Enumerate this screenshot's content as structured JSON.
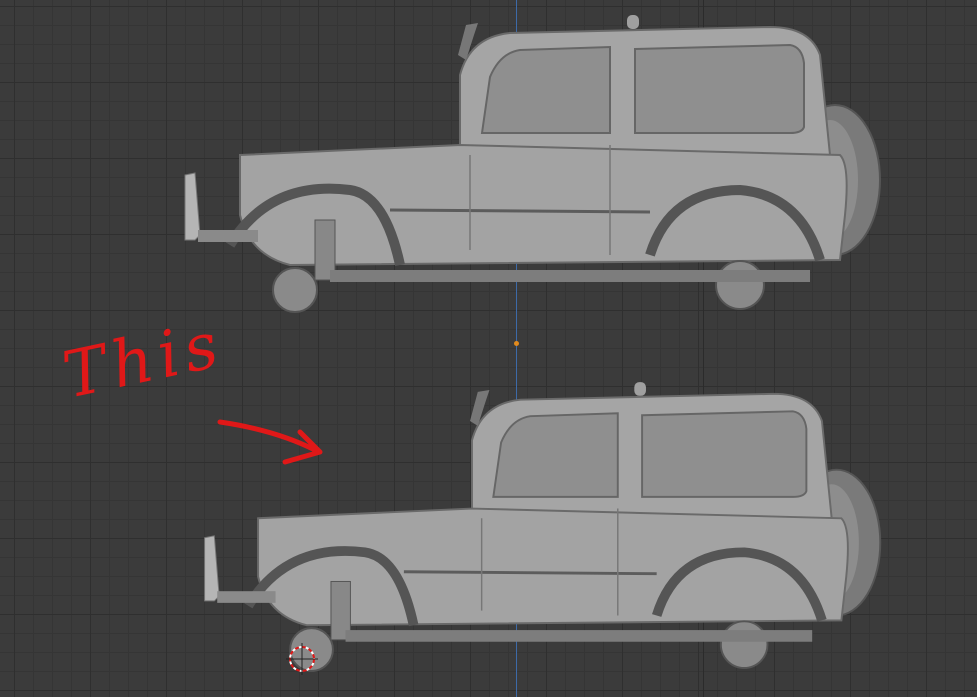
{
  "viewport": {
    "grid_color": "#2f2f2f",
    "background_color": "#3b3b3b",
    "y_axis_color": "#3d6aa8",
    "origin_color": "#e08a1e"
  },
  "annotation": {
    "text": "This",
    "color": "#e01818",
    "arrow_icon": "red-arrow-icon"
  },
  "models": [
    {
      "name": "jeep-model-top",
      "body_color": "#9a9a9a"
    },
    {
      "name": "jeep-model-bottom",
      "body_color": "#9a9a9a"
    }
  ],
  "cursor": {
    "icon": "3d-cursor-icon",
    "color": "#e01818"
  }
}
